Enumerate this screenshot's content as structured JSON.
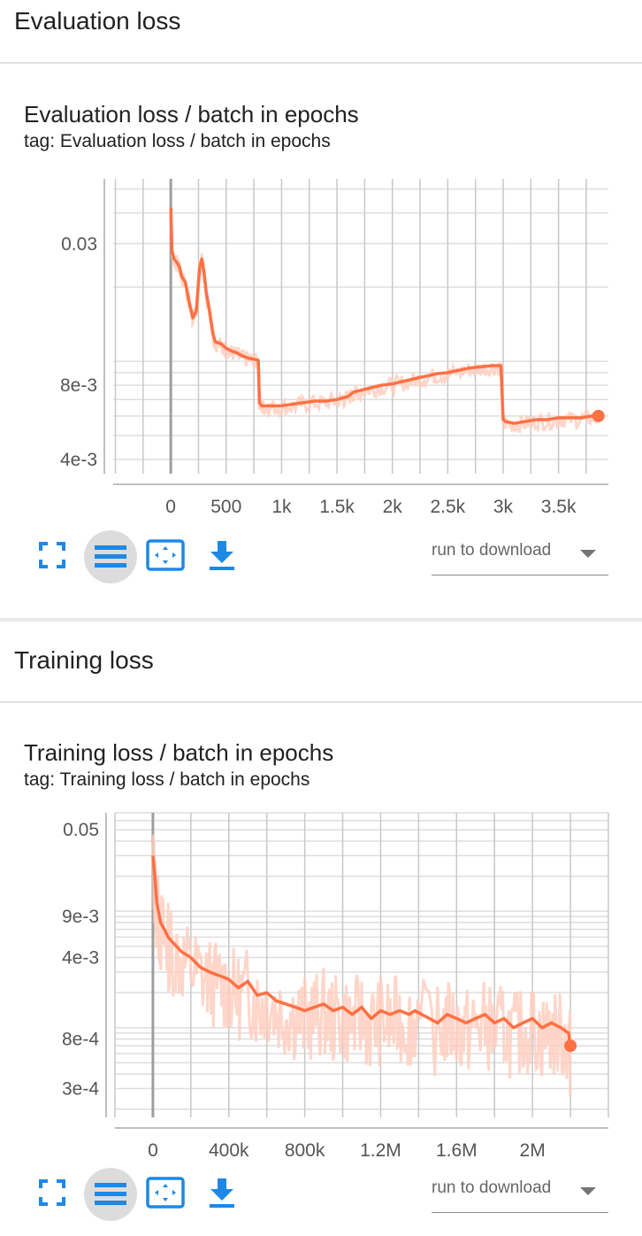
{
  "colors": {
    "accent": "#ff7043",
    "accent_light": "#ffccbc",
    "icon_blue": "#1e88e5",
    "grid": "#c8c8c8"
  },
  "icons": [
    "fullscreen-icon",
    "list-icon",
    "fit-domain-icon",
    "download-icon",
    "dropdown-arrow-icon"
  ],
  "sections": [
    {
      "title": "Evaluation loss",
      "card_title": "Evaluation loss / batch in epochs",
      "tag": "tag: Evaluation loss / batch in epochs",
      "run_select_label": "run to download",
      "chart_data": {
        "type": "line",
        "xlim": [
          -520,
          3950
        ],
        "ylim": [
          0.0035,
          0.055
        ],
        "yscale": "log",
        "x_ticks": [
          "0",
          "500",
          "1k",
          "1.5k",
          "2k",
          "2.5k",
          "3k",
          "3.5k"
        ],
        "x_tick_values": [
          0,
          500,
          1000,
          1500,
          2000,
          2500,
          3000,
          3500
        ],
        "y_ticks": [
          "0.03",
          "8e-3",
          "4e-3"
        ],
        "y_tick_values": [
          0.03,
          0.008,
          0.004
        ],
        "grid": true,
        "x": [
          0,
          10,
          30,
          60,
          80,
          100,
          130,
          150,
          170,
          200,
          230,
          260,
          280,
          300,
          320,
          350,
          380,
          400,
          450,
          500,
          550,
          600,
          650,
          700,
          750,
          790,
          800,
          820,
          850,
          900,
          1000,
          1100,
          1200,
          1300,
          1400,
          1500,
          1550,
          1600,
          1650,
          1700,
          1800,
          1900,
          2000,
          2100,
          2200,
          2300,
          2400,
          2500,
          2600,
          2700,
          2800,
          2900,
          2980,
          3000,
          3020,
          3100,
          3200,
          3300,
          3400,
          3500,
          3600,
          3700,
          3800,
          3860
        ],
        "values": [
          0.042,
          0.028,
          0.026,
          0.025,
          0.024,
          0.022,
          0.021,
          0.019,
          0.017,
          0.015,
          0.016,
          0.024,
          0.026,
          0.023,
          0.019,
          0.016,
          0.013,
          0.012,
          0.0118,
          0.0113,
          0.011,
          0.0108,
          0.0105,
          0.0103,
          0.0102,
          0.0101,
          0.0068,
          0.0066,
          0.0066,
          0.0066,
          0.0066,
          0.0067,
          0.0068,
          0.0069,
          0.0069,
          0.007,
          0.0071,
          0.0072,
          0.0075,
          0.0076,
          0.0078,
          0.008,
          0.0081,
          0.0083,
          0.0085,
          0.0087,
          0.0089,
          0.009,
          0.0092,
          0.0094,
          0.0095,
          0.0096,
          0.0096,
          0.0058,
          0.0057,
          0.0056,
          0.0057,
          0.0058,
          0.0058,
          0.0059,
          0.0059,
          0.0059,
          0.006,
          0.006
        ]
      }
    },
    {
      "title": "Training loss",
      "card_title": "Training loss / batch in epochs",
      "tag": "tag: Training loss / batch in epochs",
      "run_select_label": "run to download",
      "chart_data": {
        "type": "line",
        "xlim": [
          -200000,
          2400000
        ],
        "ylim": [
          0.00017,
          0.07
        ],
        "yscale": "log",
        "x_ticks": [
          "0",
          "400k",
          "800k",
          "1.2M",
          "1.6M",
          "2M"
        ],
        "x_tick_values": [
          0,
          400000,
          800000,
          1200000,
          1600000,
          2000000
        ],
        "y_ticks": [
          "0.05",
          "9e-3",
          "4e-3",
          "8e-4",
          "3e-4"
        ],
        "y_tick_values": [
          0.05,
          0.009,
          0.004,
          0.0008,
          0.0003
        ],
        "grid": true,
        "x": [
          0,
          10000,
          20000,
          40000,
          60000,
          80000,
          100000,
          150000,
          200000,
          250000,
          300000,
          350000,
          400000,
          450000,
          500000,
          550000,
          600000,
          650000,
          700000,
          750000,
          800000,
          850000,
          900000,
          950000,
          1000000,
          1050000,
          1100000,
          1150000,
          1200000,
          1250000,
          1300000,
          1350000,
          1380000,
          1500000,
          1550000,
          1600000,
          1650000,
          1700000,
          1750000,
          1800000,
          1850000,
          1900000,
          1950000,
          2000000,
          2050000,
          2100000,
          2150000,
          2190000,
          2200000
        ],
        "values": [
          0.03,
          0.02,
          0.012,
          0.008,
          0.007,
          0.006,
          0.0055,
          0.0045,
          0.004,
          0.0033,
          0.003,
          0.0028,
          0.0026,
          0.0022,
          0.0025,
          0.0019,
          0.002,
          0.0017,
          0.0016,
          0.0015,
          0.0014,
          0.0015,
          0.0016,
          0.0014,
          0.0015,
          0.0013,
          0.0015,
          0.0012,
          0.0014,
          0.0013,
          0.0014,
          0.0013,
          0.0014,
          0.0011,
          0.0013,
          0.0012,
          0.0011,
          0.0012,
          0.0013,
          0.0011,
          0.0012,
          0.001,
          0.0011,
          0.0012,
          0.001,
          0.0011,
          0.001,
          0.0009,
          0.0007
        ]
      }
    }
  ]
}
